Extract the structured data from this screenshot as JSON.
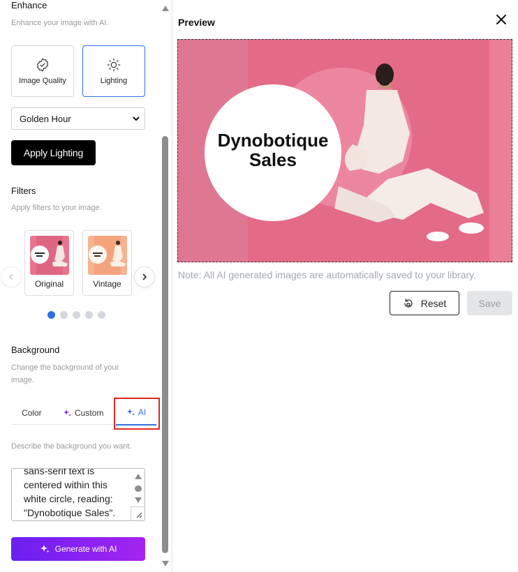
{
  "enhance": {
    "title": "Enhance",
    "description": "Enhance your image with AI.",
    "cards": [
      {
        "label": "Image Quality",
        "icon": "badge-check-icon",
        "selected": false
      },
      {
        "label": "Lighting",
        "icon": "sun-icon",
        "selected": true
      }
    ],
    "lighting_select_value": "Golden Hour",
    "apply_label": "Apply Lighting"
  },
  "filters": {
    "title": "Filters",
    "description": "Apply filters to your image.",
    "items": [
      {
        "label": "Original"
      },
      {
        "label": "Vintage"
      }
    ],
    "page_count": 5,
    "active_page": 1
  },
  "background": {
    "title": "Background",
    "description": "Change the background of your image.",
    "tabs": [
      {
        "label": "Color",
        "icon": ""
      },
      {
        "label": "Custom",
        "icon": "sparkle-icon"
      },
      {
        "label": "AI",
        "icon": "sparkle-icon",
        "active": true
      }
    ],
    "prompt_label": "Describe the background you want.",
    "prompt_text": "sans-serif text is centered within this white circle, reading: \"Dynobotique Sales\".",
    "generate_label": "Generate with AI"
  },
  "preview": {
    "title": "Preview",
    "image_text": "Dynobotique Sales",
    "note": "Note: All AI generated images are automatically saved to your library.",
    "reset_label": "Reset",
    "save_label": "Save"
  },
  "colors": {
    "accent_blue": "#2f6fe3",
    "generate_gradient_start": "#6b1ff0",
    "generate_gradient_end": "#a524ef",
    "preview_pink": "#e8758f",
    "highlight_red": "#e02424"
  }
}
